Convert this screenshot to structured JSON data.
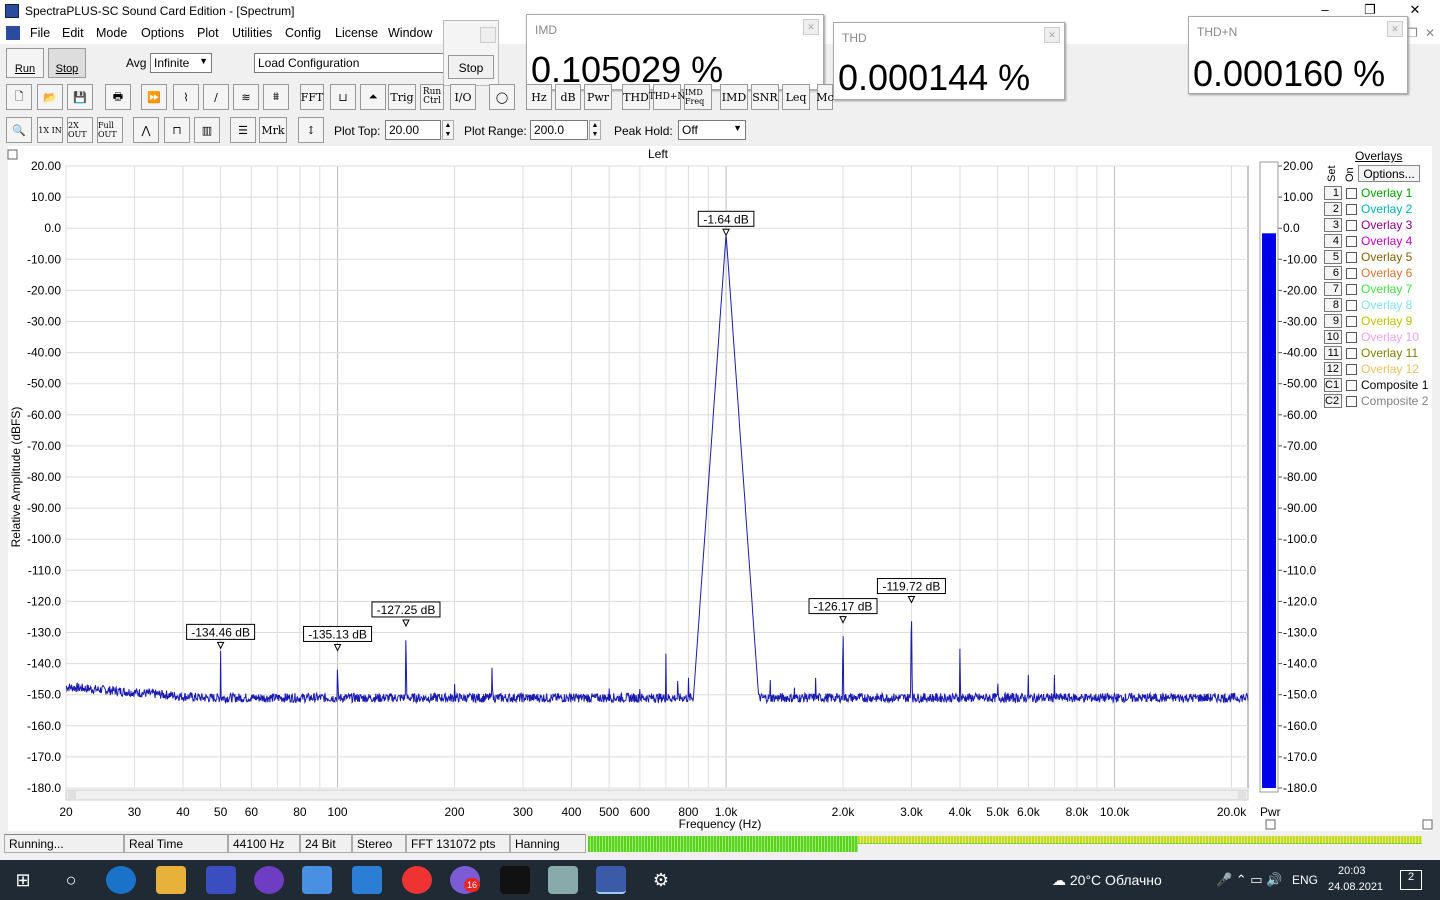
{
  "window": {
    "title": "SpectraPLUS-SC Sound Card Edition - [Spectrum]",
    "min": "–",
    "max": "❐",
    "close": "✕"
  },
  "menu": [
    "File",
    "Edit",
    "Mode",
    "Options",
    "Plot",
    "Utilities",
    "Config",
    "License",
    "Window"
  ],
  "toolbar": {
    "run": "Run",
    "stop": "Stop",
    "avg_label": "Avg",
    "avg_value": "Infinite",
    "config_value": "Load Configuration",
    "stop_popup": "Stop",
    "row1": [
      "FFT",
      "Trig",
      "Run Ctrl",
      "I/O",
      "Hz",
      "dB",
      "Pwr",
      "THD",
      "THD+N",
      "IMD Freq",
      "IMD",
      "SNR",
      "Leq",
      "Mc"
    ],
    "row2": [
      "1X IN",
      "2X OUT",
      "Full OUT",
      "Mrk"
    ],
    "plot_top_label": "Plot Top:",
    "plot_top": "20.00",
    "plot_range_label": "Plot Range:",
    "plot_range": "200.0",
    "peak_hold_label": "Peak Hold:",
    "peak_hold": "Off"
  },
  "meters": [
    {
      "label": "IMD",
      "value": "0.105029 %"
    },
    {
      "label": "THD",
      "value": "0.000144 %"
    },
    {
      "label": "THD+N",
      "value": "0.000160 %"
    }
  ],
  "plot": {
    "channel": "Left",
    "xlabel": "Frequency (Hz)",
    "ylabel": "Relative Amplitude (dBFS)",
    "pwr_label": "Pwr"
  },
  "chart_data": {
    "type": "line",
    "title": "Left",
    "xlabel": "Frequency (Hz)",
    "ylabel": "Relative Amplitude (dBFS)",
    "xscale": "log",
    "xlim": [
      20,
      22050
    ],
    "ylim": [
      -180,
      20
    ],
    "grid": true,
    "x_ticks": [
      [
        "20",
        20
      ],
      [
        "30",
        30
      ],
      [
        "40",
        40
      ],
      [
        "50",
        50
      ],
      [
        "60",
        60
      ],
      [
        "80",
        80
      ],
      [
        "100",
        100
      ],
      [
        "200",
        200
      ],
      [
        "300",
        300
      ],
      [
        "400",
        400
      ],
      [
        "500",
        500
      ],
      [
        "600",
        600
      ],
      [
        "800",
        800
      ],
      [
        "1.0k",
        1000
      ],
      [
        "2.0k",
        2000
      ],
      [
        "3.0k",
        3000
      ],
      [
        "4.0k",
        4000
      ],
      [
        "5.0k",
        5000
      ],
      [
        "6.0k",
        6000
      ],
      [
        "8.0k",
        8000
      ],
      [
        "10.0k",
        10000
      ],
      [
        "20.0k",
        20000
      ]
    ],
    "y_ticks": [
      "20.00",
      "10.00",
      "0.0",
      "-10.00",
      "-20.00",
      "-30.00",
      "-40.00",
      "-50.00",
      "-60.00",
      "-70.00",
      "-80.00",
      "-90.00",
      "-100.0",
      "-110.0",
      "-120.0",
      "-130.0",
      "-140.0",
      "-150.0",
      "-160.0",
      "-170.0",
      "-180.0"
    ],
    "noise_floor": -151,
    "peaks": [
      [
        50,
        -134.46
      ],
      [
        100,
        -135.13
      ],
      [
        150,
        -127.25
      ],
      [
        200,
        -144
      ],
      [
        250,
        -136
      ],
      [
        300,
        -147
      ],
      [
        350,
        -148
      ],
      [
        400,
        -144
      ],
      [
        450,
        -145
      ],
      [
        500,
        -144
      ],
      [
        550,
        -145
      ],
      [
        600,
        -144
      ],
      [
        650,
        -144
      ],
      [
        700,
        -136
      ],
      [
        750,
        -140
      ],
      [
        800,
        -141
      ],
      [
        850,
        -143
      ],
      [
        900,
        -140
      ],
      [
        1000,
        -1.64
      ],
      [
        1100,
        -144
      ],
      [
        1150,
        -145
      ],
      [
        1200,
        -142
      ],
      [
        1250,
        -145
      ],
      [
        1300,
        -143
      ],
      [
        1400,
        -145
      ],
      [
        1500,
        -145
      ],
      [
        1600,
        -145
      ],
      [
        1700,
        -144
      ],
      [
        1800,
        -146
      ],
      [
        2000,
        -126.17
      ],
      [
        2100,
        -146
      ],
      [
        2200,
        -145
      ],
      [
        2300,
        -148
      ],
      [
        3000,
        -119.72
      ],
      [
        4000,
        -132
      ],
      [
        5000,
        -140
      ],
      [
        6000,
        -142
      ],
      [
        7000,
        -142
      ],
      [
        8000,
        -147
      ],
      [
        9000,
        -152
      ],
      [
        12000,
        -152
      ],
      [
        16000,
        -150
      ],
      [
        18000,
        -150
      ],
      [
        20000,
        -150
      ]
    ],
    "markers": [
      {
        "label": "-134.46 dB",
        "x": 50,
        "y": -134.46
      },
      {
        "label": "-135.13 dB",
        "x": 100,
        "y": -135.13
      },
      {
        "label": "-127.25 dB",
        "x": 150,
        "y": -127.25
      },
      {
        "label": "-1.64 dB",
        "x": 1000,
        "y": -1.64
      },
      {
        "label": "-126.17 dB",
        "x": 2000,
        "y": -126.17
      },
      {
        "label": "-119.72 dB",
        "x": 3000,
        "y": -119.72
      }
    ],
    "power_bar": {
      "level": -1.64
    }
  },
  "overlays": {
    "title": "Overlays",
    "set_label": "Set",
    "on_label": "On",
    "options": "Options...",
    "items": [
      {
        "num": "1",
        "name": "Overlay 1",
        "color": "#00a000"
      },
      {
        "num": "2",
        "name": "Overlay 2",
        "color": "#00b0b0"
      },
      {
        "num": "3",
        "name": "Overlay 3",
        "color": "#900090"
      },
      {
        "num": "4",
        "name": "Overlay 4",
        "color": "#c000c0"
      },
      {
        "num": "5",
        "name": "Overlay 5",
        "color": "#806000"
      },
      {
        "num": "6",
        "name": "Overlay 6",
        "color": "#e07030"
      },
      {
        "num": "7",
        "name": "Overlay 7",
        "color": "#40e040"
      },
      {
        "num": "8",
        "name": "Overlay 8",
        "color": "#80e0f0"
      },
      {
        "num": "9",
        "name": "Overlay 9",
        "color": "#c0c000"
      },
      {
        "num": "10",
        "name": "Overlay 10",
        "color": "#f0a0f0"
      },
      {
        "num": "11",
        "name": "Overlay 11",
        "color": "#808000"
      },
      {
        "num": "12",
        "name": "Overlay 12",
        "color": "#f0c060"
      },
      {
        "num": "C1",
        "name": "Composite 1",
        "color": "#000000"
      },
      {
        "num": "C2",
        "name": "Composite 2",
        "color": "#808080"
      }
    ]
  },
  "status": [
    "Running...",
    "Real Time",
    "44100 Hz",
    "24 Bit",
    "Stereo",
    "FFT 131072 pts",
    "Hanning"
  ],
  "taskbar": {
    "weather": "20°C Облачно",
    "lang": "ENG",
    "time": "20:03",
    "date": "24.08.2021",
    "badge": "16",
    "notif": "2"
  }
}
